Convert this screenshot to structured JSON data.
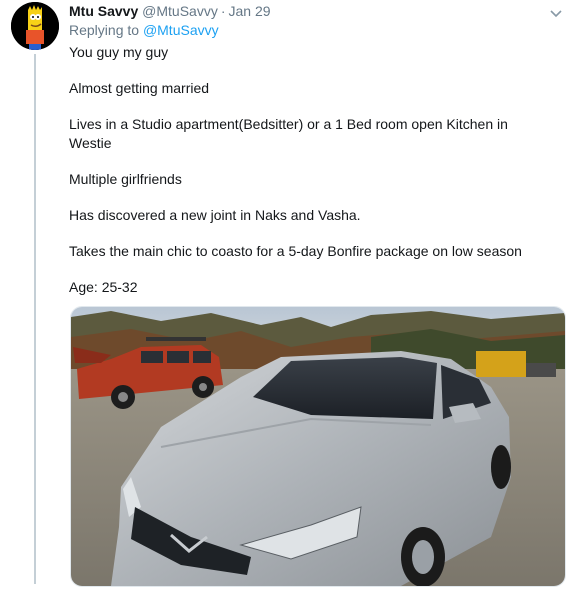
{
  "tweet": {
    "author_name": "Mtu Savvy",
    "author_handle": "@MtuSavvy",
    "separator": "·",
    "date": "Jan 29",
    "replying_prefix": "Replying to ",
    "replying_to": "@MtuSavvy",
    "paragraphs": [
      "You guy my guy",
      "Almost getting married",
      "Lives in a Studio apartment(Bedsitter) or a 1 Bed room open Kitchen in Westie",
      "Multiple girlfriends",
      "Has discovered a new joint in Naks and Vasha.",
      "Takes the main chic to coasto for a 5-day Bonfire package on low season",
      "Age: 25-32"
    ],
    "caret_icon": "chevron-down-icon"
  },
  "colors": {
    "link": "#1da1f2",
    "secondary_text": "#657786",
    "thread_line": "#c4cfd6"
  }
}
